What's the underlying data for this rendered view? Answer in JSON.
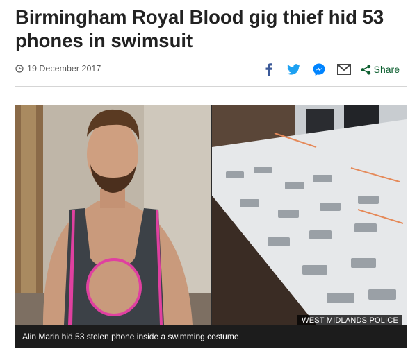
{
  "article": {
    "headline": "Birmingham Royal Blood gig thief hid 53 phones in swimsuit",
    "date": "19 December 2017"
  },
  "share": {
    "label": "Share",
    "icons": [
      "facebook-icon",
      "twitter-icon",
      "messenger-icon",
      "email-icon",
      "share-icon"
    ]
  },
  "figure": {
    "credit": "WEST MIDLANDS POLICE",
    "caption": "Alin Marin hid 53 stolen phone inside a swimming costume"
  },
  "colors": {
    "headline": "#222222",
    "facebook": "#3b5998",
    "twitter": "#1da1f2",
    "messenger": "#0084ff",
    "share": "#0b5e2e",
    "caption_bg": "#1c1c1c",
    "swimsuit_trim": "#e040a0"
  }
}
